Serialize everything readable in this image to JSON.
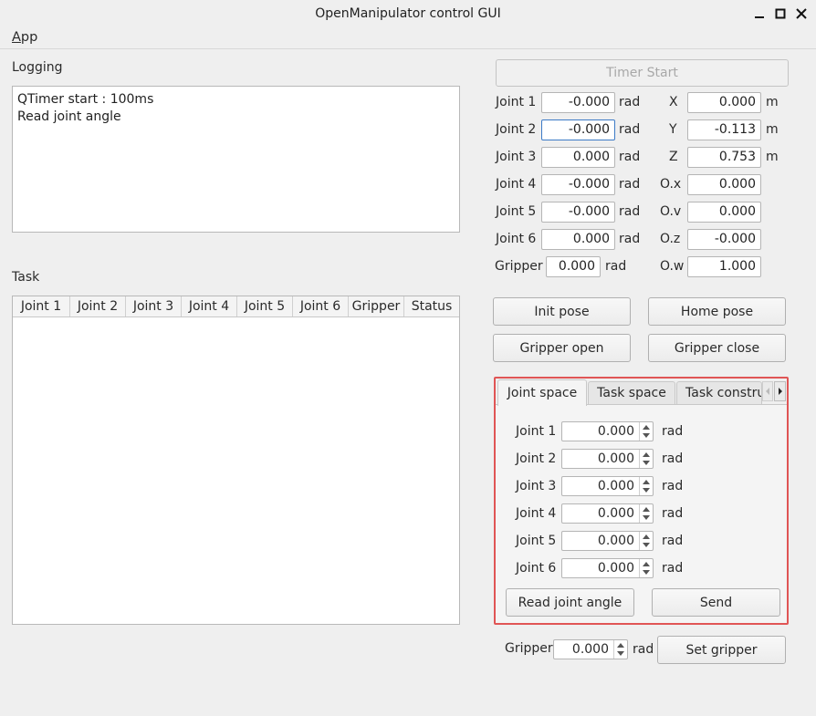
{
  "window": {
    "title": "OpenManipulator control GUI"
  },
  "menu": {
    "app_prefix": "A",
    "app_rest": "pp"
  },
  "logging": {
    "label": "Logging",
    "lines": [
      "QTimer start : 100ms",
      "Read joint angle"
    ]
  },
  "task": {
    "label": "Task",
    "columns": [
      "Joint 1",
      "Joint 2",
      "Joint 3",
      "Joint 4",
      "Joint 5",
      "Joint 6",
      "Gripper",
      "Status"
    ]
  },
  "timer_button": "Timer Start",
  "joints": [
    {
      "label": "Joint 1",
      "value": "-0.000",
      "unit": "rad"
    },
    {
      "label": "Joint 2",
      "value": "-0.000",
      "unit": "rad"
    },
    {
      "label": "Joint 3",
      "value": "0.000",
      "unit": "rad"
    },
    {
      "label": "Joint 4",
      "value": "-0.000",
      "unit": "rad"
    },
    {
      "label": "Joint 5",
      "value": "-0.000",
      "unit": "rad"
    },
    {
      "label": "Joint 6",
      "value": "0.000",
      "unit": "rad"
    }
  ],
  "gripper_readout": {
    "label": "Gripper",
    "value": "0.000",
    "unit": "rad"
  },
  "pose": [
    {
      "label": "X",
      "value": "0.000",
      "unit": "m"
    },
    {
      "label": "Y",
      "value": "-0.113",
      "unit": "m"
    },
    {
      "label": "Z",
      "value": "0.753",
      "unit": "m"
    },
    {
      "label": "O.x",
      "value": "0.000",
      "unit": ""
    },
    {
      "label": "O.v",
      "value": "0.000",
      "unit": ""
    },
    {
      "label": "O.z",
      "value": "-0.000",
      "unit": ""
    },
    {
      "label": "O.w",
      "value": "1.000",
      "unit": ""
    }
  ],
  "buttons": {
    "init_pose": "Init pose",
    "home_pose": "Home pose",
    "gripper_open": "Gripper open",
    "gripper_close": "Gripper close"
  },
  "tabs": {
    "items": [
      "Joint space",
      "Task space",
      "Task constru"
    ],
    "active": "Joint space"
  },
  "joint_space": {
    "rows": [
      {
        "label": "Joint 1",
        "value": "0.000",
        "unit": "rad"
      },
      {
        "label": "Joint 2",
        "value": "0.000",
        "unit": "rad"
      },
      {
        "label": "Joint 3",
        "value": "0.000",
        "unit": "rad"
      },
      {
        "label": "Joint 4",
        "value": "0.000",
        "unit": "rad"
      },
      {
        "label": "Joint 5",
        "value": "0.000",
        "unit": "rad"
      },
      {
        "label": "Joint 6",
        "value": "0.000",
        "unit": "rad"
      }
    ],
    "read_button": "Read joint angle",
    "send_button": "Send"
  },
  "gripper_set": {
    "label": "Gripper",
    "value": "0.000",
    "unit": "rad",
    "button": "Set gripper"
  },
  "colors": {
    "accent_focus": "#3d7bc6",
    "tab_frame": "#e05555"
  }
}
